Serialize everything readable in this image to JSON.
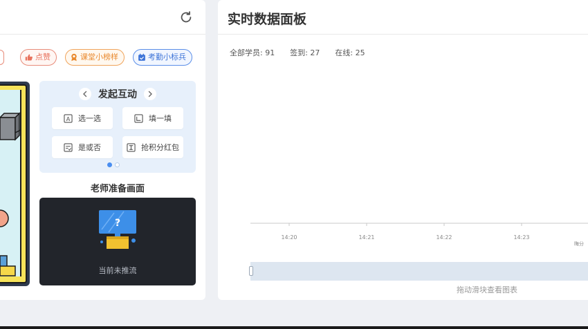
{
  "left_panel": {
    "tags": [
      {
        "label": "点赞",
        "color": "#e8735e",
        "icon": "thumbs-up-icon"
      },
      {
        "label": "课堂小榜样",
        "color": "#e98a2f",
        "icon": "medal-icon"
      },
      {
        "label": "考勤小标兵",
        "color": "#3d74d8",
        "icon": "calendar-check-icon"
      }
    ],
    "interaction": {
      "title": "发起互动",
      "buttons": [
        {
          "label": "选一选",
          "icon": "choice-icon"
        },
        {
          "label": "填一填",
          "icon": "fill-blank-icon"
        },
        {
          "label": "是或否",
          "icon": "yes-no-icon"
        },
        {
          "label": "抢积分红包",
          "icon": "red-packet-icon"
        }
      ],
      "page_index": 1,
      "page_count": 2
    },
    "prep": {
      "title": "老师准备画面",
      "status_text": "当前未推流"
    }
  },
  "right_panel": {
    "title": "实时数据面板",
    "stats": [
      {
        "label": "全部学员: 91"
      },
      {
        "label": "签到: 27"
      },
      {
        "label": "在线: 25"
      }
    ],
    "slider_hint": "拖动滑块查看图表"
  },
  "chart_data": {
    "type": "line",
    "x_ticks": [
      "14:20",
      "14:21",
      "14:22",
      "14:23"
    ],
    "series": [],
    "partial_label": "晦分"
  },
  "colors": {
    "accent": "#4a8ef0",
    "like": "#e8735e",
    "model": "#e98a2f",
    "attend": "#3d74d8"
  }
}
